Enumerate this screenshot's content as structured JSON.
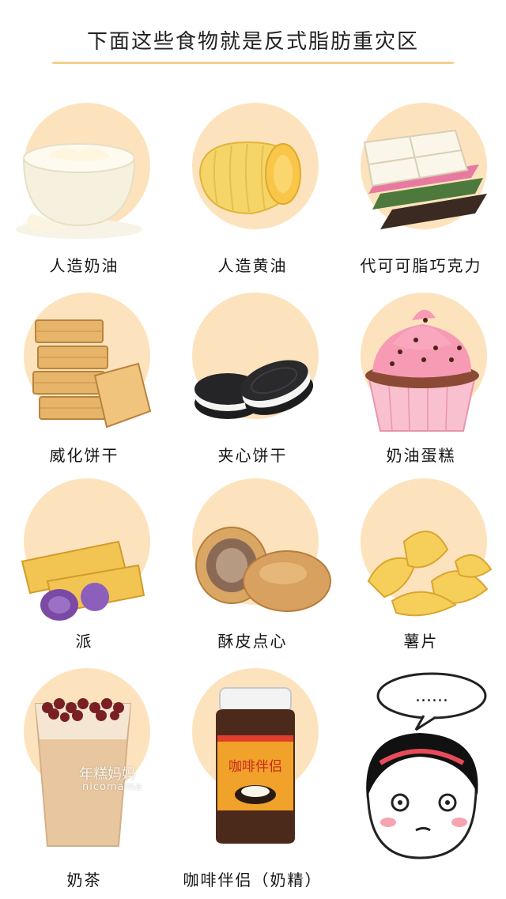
{
  "title": "下面这些食物就是反式脂肪重灾区",
  "foods": [
    {
      "label": "人造奶油",
      "icon": "cream-bowl-icon"
    },
    {
      "label": "人造黄油",
      "icon": "butter-curl-icon"
    },
    {
      "label": "代可可脂巧克力",
      "icon": "chocolate-bars-icon"
    },
    {
      "label": "威化饼干",
      "icon": "wafer-stack-icon"
    },
    {
      "label": "夹心饼干",
      "icon": "sandwich-cookie-icon"
    },
    {
      "label": "奶油蛋糕",
      "icon": "cupcake-icon"
    },
    {
      "label": "派",
      "icon": "pie-pastry-icon"
    },
    {
      "label": "酥皮点心",
      "icon": "puff-pastry-icon"
    },
    {
      "label": "薯片",
      "icon": "potato-chips-icon"
    },
    {
      "label": "奶茶",
      "icon": "milk-tea-cup-icon"
    },
    {
      "label": "咖啡伴侣（奶精）",
      "icon": "coffee-creamer-jar-icon"
    }
  ],
  "jar_text": "咖啡伴侣",
  "watermark": {
    "line1": "年糕妈妈",
    "line2": "nicomama"
  },
  "thinking_bubble": "......",
  "colors": {
    "circle": "#fce3bd",
    "underline": "#f3cf8f"
  }
}
